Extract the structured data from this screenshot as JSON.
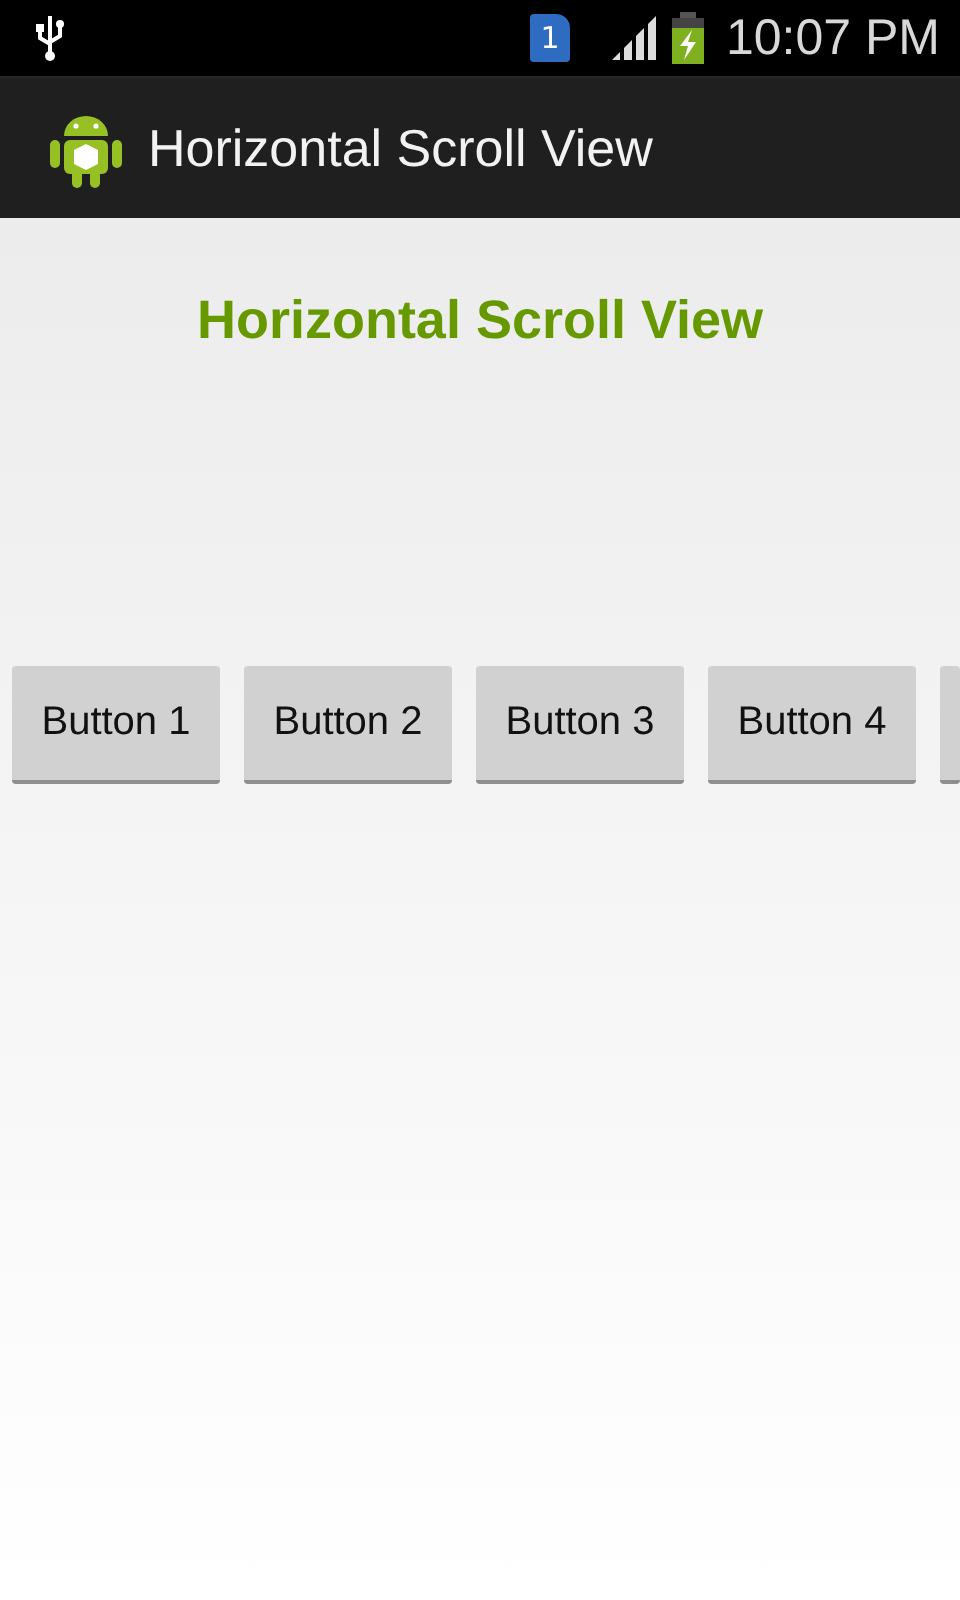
{
  "status_bar": {
    "time": "10:07 PM",
    "notification_badge": "1"
  },
  "action_bar": {
    "title": "Horizontal Scroll View"
  },
  "heading": "Horizontal Scroll View",
  "buttons": [
    {
      "kind": "full",
      "label": "Button 1"
    },
    {
      "kind": "full",
      "label": "Button 2"
    },
    {
      "kind": "full",
      "label": "Button 3"
    },
    {
      "kind": "full",
      "label": "Button 4"
    },
    {
      "kind": "cut"
    }
  ]
}
